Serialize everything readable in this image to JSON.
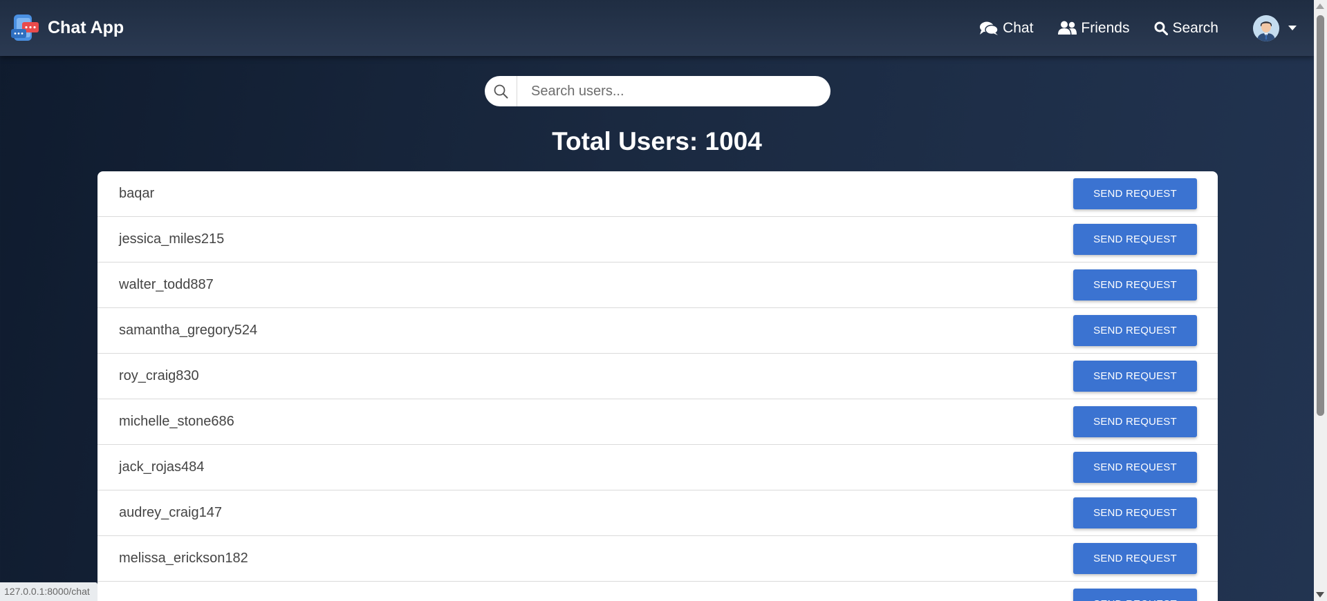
{
  "app": {
    "title": "Chat App"
  },
  "nav": {
    "chat_label": "Chat",
    "friends_label": "Friends",
    "search_label": "Search"
  },
  "search": {
    "placeholder": "Search users...",
    "value": ""
  },
  "summary": {
    "total_users_text": "Total Users: 1004"
  },
  "users": [
    {
      "name": "baqar",
      "action": "SEND REQUEST"
    },
    {
      "name": "jessica_miles215",
      "action": "SEND REQUEST"
    },
    {
      "name": "walter_todd887",
      "action": "SEND REQUEST"
    },
    {
      "name": "samantha_gregory524",
      "action": "SEND REQUEST"
    },
    {
      "name": "roy_craig830",
      "action": "SEND REQUEST"
    },
    {
      "name": "michelle_stone686",
      "action": "SEND REQUEST"
    },
    {
      "name": "jack_rojas484",
      "action": "SEND REQUEST"
    },
    {
      "name": "audrey_craig147",
      "action": "SEND REQUEST"
    },
    {
      "name": "melissa_erickson182",
      "action": "SEND REQUEST"
    },
    {
      "name": "",
      "action": "SEND REQUEST"
    }
  ],
  "status_bar": {
    "url": "127.0.0.1:8000/chat"
  },
  "colors": {
    "accent": "#3b73d1",
    "background_dark": "#1a2940",
    "navbar": "#26354c"
  },
  "icons": {
    "brand": "chat-app-logo-icon",
    "chat": "comments-icon",
    "friends": "user-friends-icon",
    "search": "search-icon",
    "avatar": "user-avatar-icon",
    "dropdown": "caret-down-icon"
  }
}
